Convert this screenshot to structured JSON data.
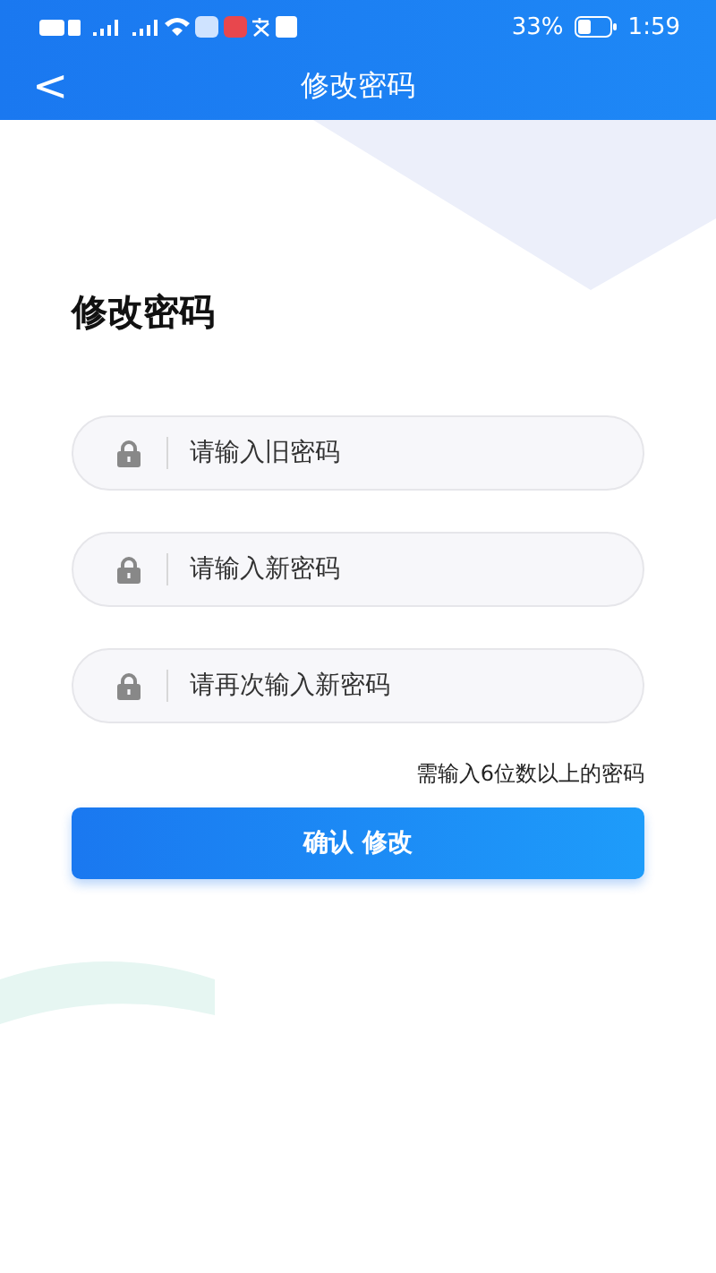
{
  "status_bar": {
    "battery_percent": "33%",
    "time": "1:59"
  },
  "header": {
    "back": "<",
    "title": "修改密码"
  },
  "heading": "修改密码",
  "fields": [
    {
      "placeholder": "请输入旧密码"
    },
    {
      "placeholder": "请输入新密码"
    },
    {
      "placeholder": "请再次输入新密码"
    }
  ],
  "hint": "需输入6位数以上的密码",
  "submit": "确认 修改"
}
